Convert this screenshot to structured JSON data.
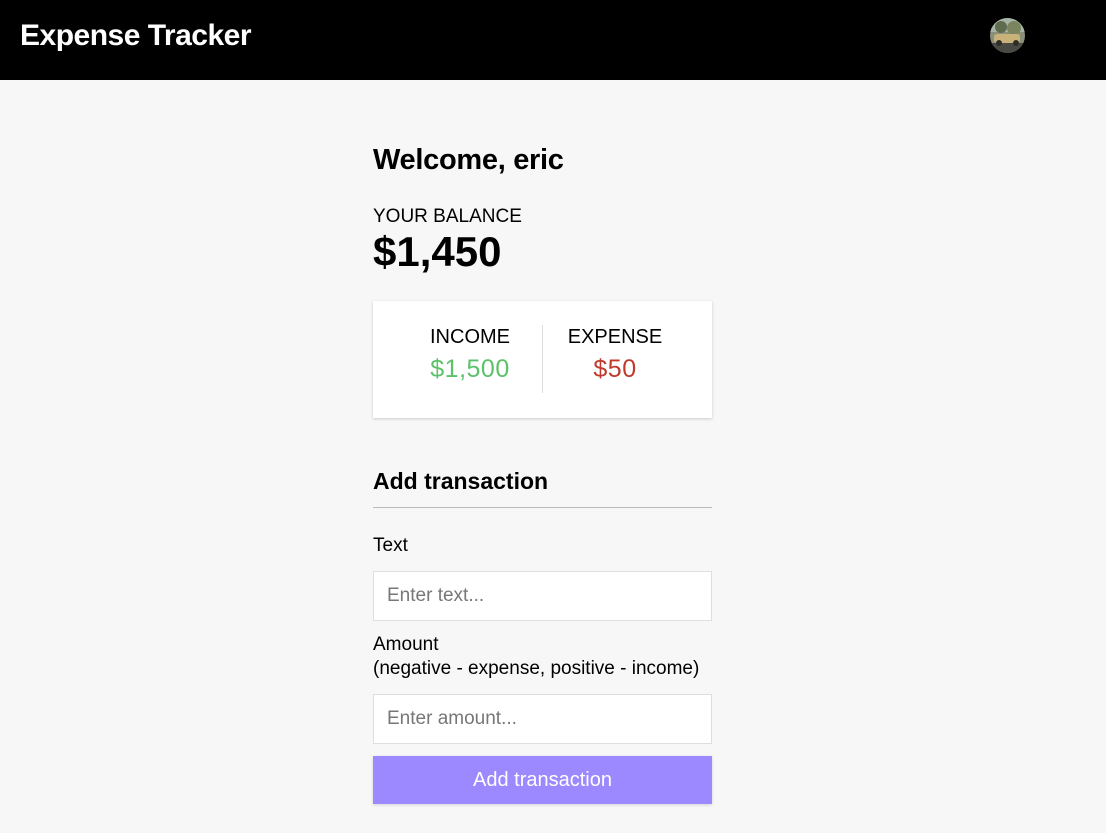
{
  "header": {
    "brand": "Expense Tracker",
    "avatar_icon": "user-avatar-icon"
  },
  "welcome": {
    "prefix": "Welcome, ",
    "username": "eric",
    "text": "Welcome, eric"
  },
  "balance": {
    "label": "YOUR BALANCE",
    "value": "$1,450"
  },
  "summary": {
    "income_label": "INCOME",
    "income_value": "$1,500",
    "expense_label": "EXPENSE",
    "expense_value": "$50"
  },
  "form": {
    "title": "Add transaction",
    "text_label": "Text",
    "text_placeholder": "Enter text...",
    "text_value": "",
    "amount_label_line1": "Amount",
    "amount_label_line2": "(negative - expense, positive - income)",
    "amount_placeholder": "Enter amount...",
    "amount_value": "",
    "submit_label": "Add transaction"
  },
  "colors": {
    "navbar": "#000000",
    "background": "#f7f7f7",
    "income": "#5cc26a",
    "expense": "#c0392b",
    "button": "#9c88ff"
  }
}
